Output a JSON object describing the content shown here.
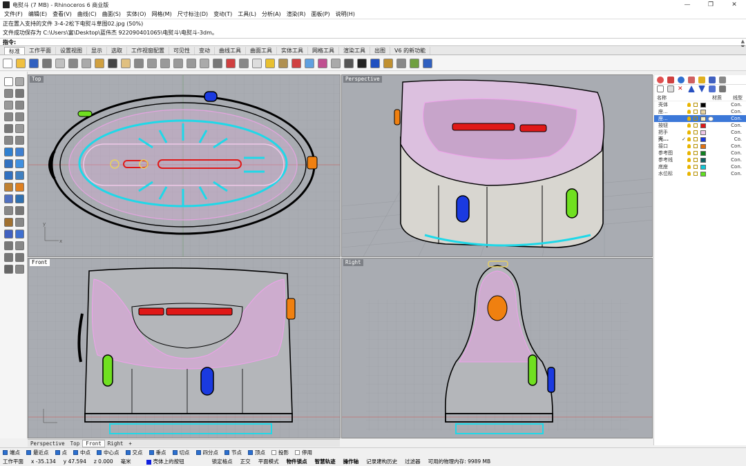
{
  "window": {
    "title": "电熨斗 (7 MB) - Rhinoceros 6 商业版",
    "controls": [
      "—",
      "❐",
      "✕"
    ]
  },
  "menu": [
    "文件(F)",
    "编辑(E)",
    "查看(V)",
    "曲线(C)",
    "曲面(S)",
    "实体(O)",
    "网格(M)",
    "尺寸标注(D)",
    "变动(T)",
    "工具(L)",
    "分析(A)",
    "渲染(R)",
    "面板(P)",
    "说明(H)"
  ],
  "command_history": [
    "正在置入支持的文件 3-4-2松下电熨斗草图02.jpg (50%)",
    "文件成功保存为 C:\\Users\\富\\Desktop\\蓝伟杰 922090401065\\电熨斗\\电熨斗-3dm。"
  ],
  "command_prompt": "指令:",
  "toolbar_tabs": [
    "标准",
    "工作平面",
    "设置视图",
    "显示",
    "选取",
    "工作视窗配置",
    "可见性",
    "变动",
    "曲线工具",
    "曲面工具",
    "实体工具",
    "网格工具",
    "渲染工具",
    "出图",
    "V6 的新功能"
  ],
  "active_tab": "标准",
  "viewports": {
    "top": {
      "label": "Top"
    },
    "perspective": {
      "label": "Perspective"
    },
    "front": {
      "label": "Front"
    },
    "right": {
      "label": "Right"
    }
  },
  "viewport_tabs": [
    "Perspective",
    "Top",
    "Front",
    "Right",
    "+"
  ],
  "active_viewport_tab": "Front",
  "layers_panel": {
    "headers": {
      "name": "名称",
      "material": "材质",
      "linetype": "线型"
    },
    "layers": [
      {
        "name": "壳体",
        "color": "#000000",
        "linetype": "Con.",
        "current": false,
        "selected": false
      },
      {
        "name": "座...",
        "color": "#e8d4a0",
        "linetype": "Con.",
        "current": false,
        "selected": false
      },
      {
        "name": "座...",
        "color": "#f6f0c8",
        "linetype": "Con.",
        "current": false,
        "selected": true
      },
      {
        "name": "按钮",
        "color": "#e01818",
        "linetype": "Con.",
        "current": false,
        "selected": false
      },
      {
        "name": "把手",
        "color": "#f0c8e8",
        "linetype": "Con.",
        "current": false,
        "selected": false
      },
      {
        "name": "壳...",
        "color": "#1a3ae0",
        "linetype": "Co.",
        "current": true,
        "selected": false
      },
      {
        "name": "接口",
        "color": "#e07010",
        "linetype": "Con.",
        "current": false,
        "selected": false
      },
      {
        "name": "参考图",
        "color": "#108020",
        "linetype": "Con.",
        "current": false,
        "selected": false
      },
      {
        "name": "参考线",
        "color": "#106060",
        "linetype": "Con.",
        "current": false,
        "selected": false
      },
      {
        "name": "底座",
        "color": "#10c8d8",
        "linetype": "Con.",
        "current": false,
        "selected": false
      },
      {
        "name": "水位标",
        "color": "#60e020",
        "linetype": "Con.",
        "current": false,
        "selected": false
      }
    ]
  },
  "osnaps": [
    {
      "label": "端点",
      "on": true
    },
    {
      "label": "最近点",
      "on": true
    },
    {
      "label": "点",
      "on": true
    },
    {
      "label": "中点",
      "on": true
    },
    {
      "label": "中心点",
      "on": true
    },
    {
      "label": "交点",
      "on": true
    },
    {
      "label": "垂点",
      "on": true
    },
    {
      "label": "切点",
      "on": true
    },
    {
      "label": "四分点",
      "on": true
    },
    {
      "label": "节点",
      "on": true
    },
    {
      "label": "顶点",
      "on": true
    },
    {
      "label": "投影",
      "on": false
    },
    {
      "label": "停用",
      "on": false
    }
  ],
  "status": {
    "cplane": "工作平面",
    "x": "x -35.134",
    "y": "y 47.594",
    "z": "z 0.000",
    "unit": "毫米",
    "layer": "壳体上的按钮",
    "layer_color": "#1020e0",
    "items": [
      {
        "text": "锁定格点",
        "bold": false
      },
      {
        "text": "正交",
        "bold": false
      },
      {
        "text": "平面模式",
        "bold": false
      },
      {
        "text": "物件锁点",
        "bold": true
      },
      {
        "text": "智慧轨迹",
        "bold": true
      },
      {
        "text": "操作轴",
        "bold": true
      },
      {
        "text": "记录建构历史",
        "bold": false
      },
      {
        "text": "过滤器",
        "bold": false
      },
      {
        "text": "可用的物理内存: 9989 MB",
        "bold": false
      }
    ]
  }
}
